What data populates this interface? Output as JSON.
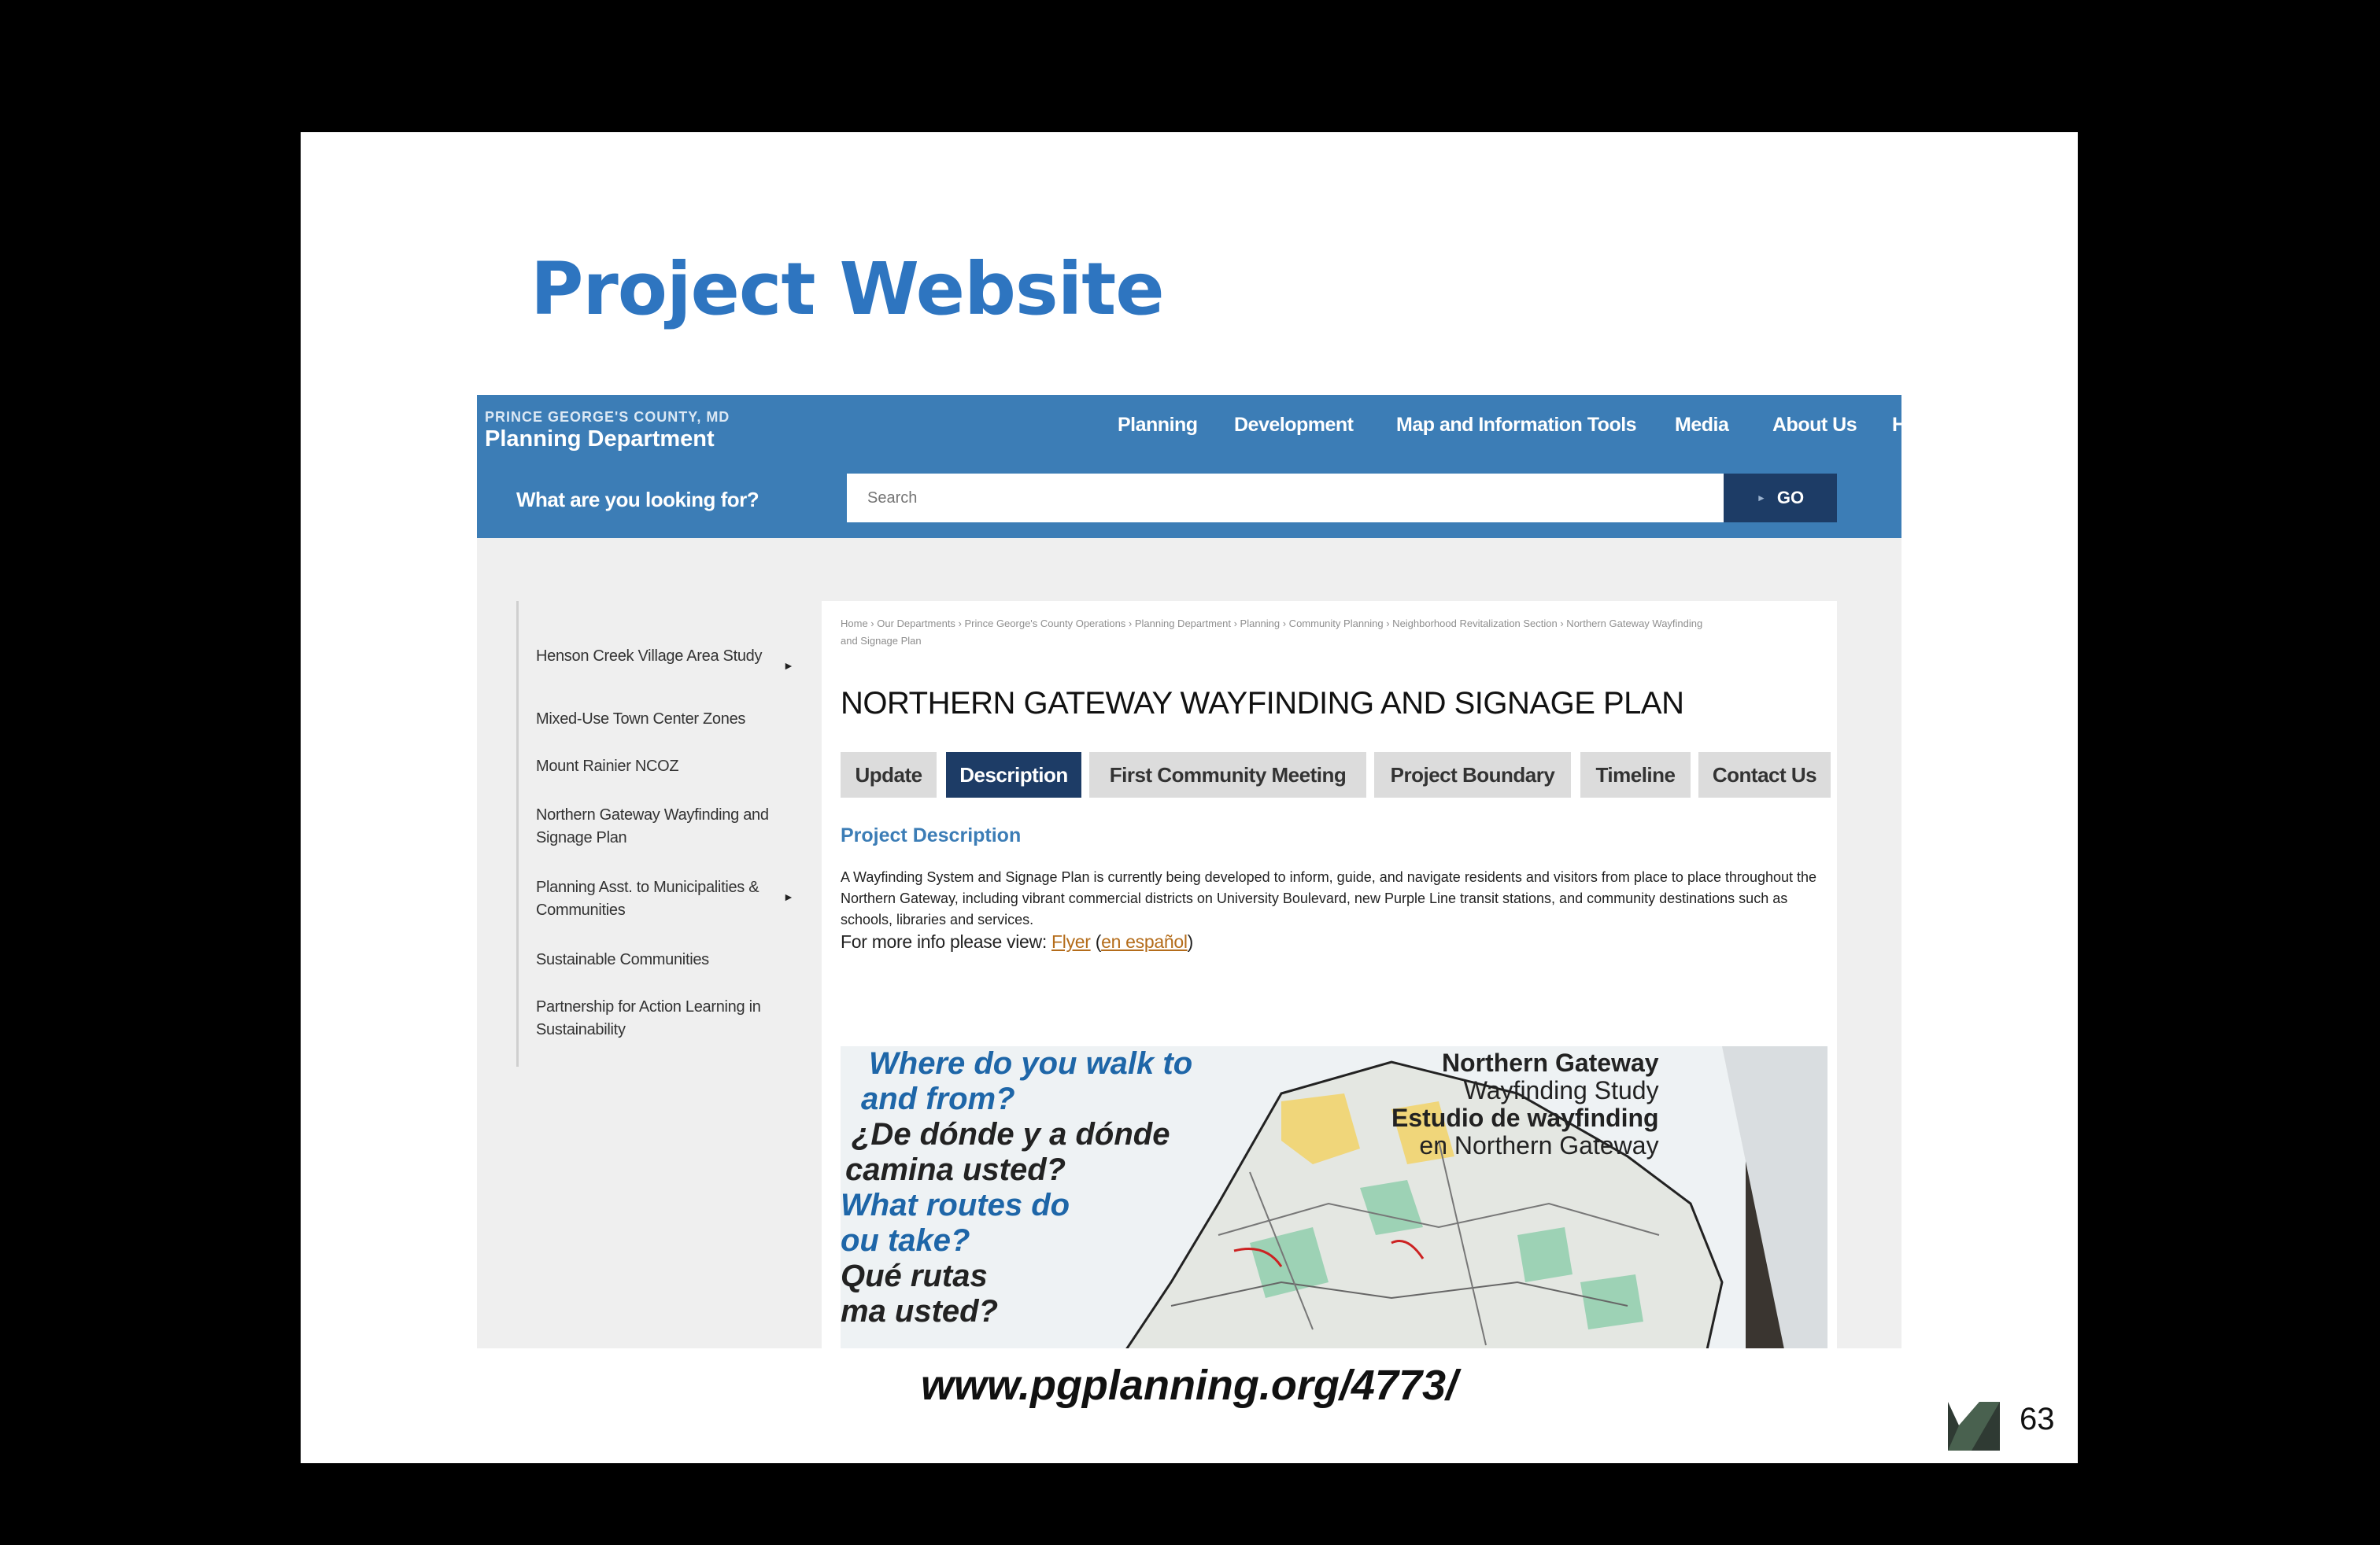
{
  "slide": {
    "title": "Project Website",
    "url": "www.pgplanning.org/4773/",
    "page_number": "63"
  },
  "site": {
    "brand_top": "PRINCE GEORGE'S COUNTY, MD",
    "brand_main": "Planning Department",
    "nav": [
      "Planning",
      "Development",
      "Map and Information Tools",
      "Media",
      "About Us",
      "H"
    ],
    "search_label": "What are you looking for?",
    "search_placeholder": "Search",
    "go_label": "GO"
  },
  "sidebar": {
    "items": [
      {
        "label": "Henson Creek Village Area Study",
        "has_arrow": true
      },
      {
        "label": "Mixed-Use Town Center Zones"
      },
      {
        "label": "Mount Rainier NCOZ"
      },
      {
        "label": "Northern Gateway Wayfinding and Signage Plan"
      },
      {
        "label": "Planning Asst. to Municipalities & Communities",
        "has_arrow": true
      },
      {
        "label": "Sustainable Communities"
      },
      {
        "label": "Partnership for Action Learning in Sustainability"
      }
    ],
    "arrow_glyph": "►"
  },
  "content": {
    "breadcrumb": "Home › Our Departments › Prince George's County Operations › Planning Department › Planning › Community Planning › Neighborhood Revitalization Section › Northern Gateway Wayfinding and Signage Plan",
    "title": "NORTHERN GATEWAY WAYFINDING AND SIGNAGE PLAN",
    "tabs": [
      "Update",
      "Description",
      "First Community Meeting",
      "Project Boundary",
      "Timeline",
      "Contact Us"
    ],
    "active_tab": "Description",
    "section_heading": "Project Description",
    "description": "A Wayfinding System and Signage Plan is currently being developed to inform, guide, and navigate residents and visitors from place to place throughout the Northern Gateway, including vibrant commercial districts on University Boulevard, new Purple Line transit stations, and community destinations such as schools, libraries and services.",
    "more_info_prefix": "For more info please view: ",
    "flyer_link": "Flyer",
    "espanol_link": "en español",
    "paren_open": "(",
    "paren_close": ")"
  },
  "poster": {
    "left_lines": [
      "Where do you walk to",
      "and from?",
      "¿De dónde y a dónde",
      "camina usted?",
      "What routes do",
      "ou take?",
      "Qué rutas",
      "ma usted?"
    ],
    "right_lines": [
      "Northern Gateway",
      "Wayfinding Study",
      "Estudio de wayfinding",
      "en Northern Gateway"
    ]
  },
  "colors": {
    "title_blue": "#2e75c0",
    "header_blue": "#3c7db6",
    "navy": "#1d3c66",
    "link_orange": "#b46c1a"
  }
}
